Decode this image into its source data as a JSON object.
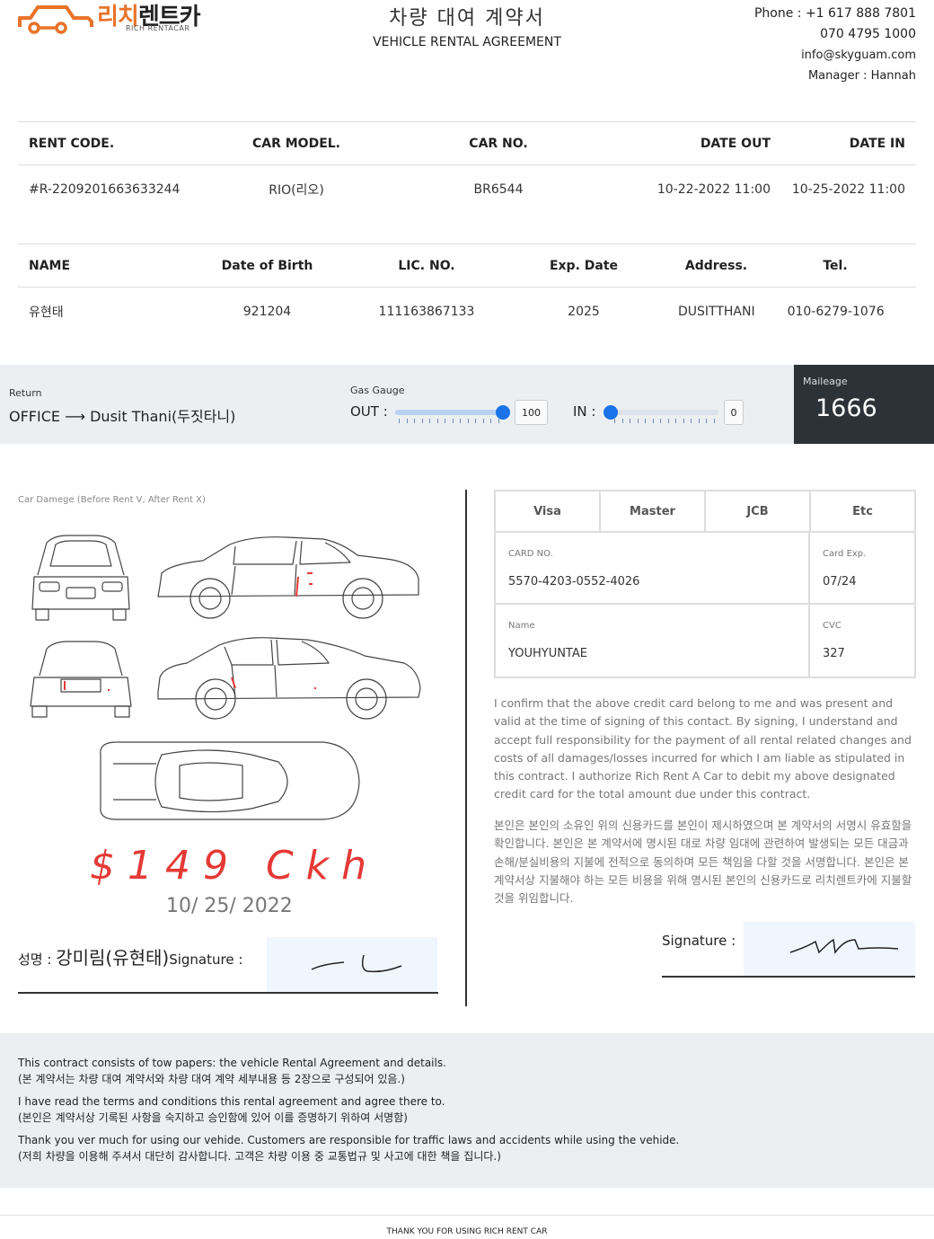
{
  "brand": {
    "name_part1": "리치",
    "name_part2": "렌트카",
    "sub": "RICH RENTACAR",
    "accent": "#e8732a"
  },
  "title": {
    "ko": "차량 대여 계약서",
    "en": "VEHICLE RENTAL AGREEMENT"
  },
  "contact": {
    "phone1": "Phone : +1 617 888 7801",
    "phone2": "070 4795 1000",
    "email": "info@skyguam.com",
    "manager": "Manager : Hannah"
  },
  "rental": {
    "headers": [
      "RENT CODE.",
      "CAR MODEL.",
      "CAR NO.",
      "DATE OUT",
      "DATE IN"
    ],
    "values": [
      "#R-2209201663633244",
      "RIO(리오)",
      "BR6544",
      "10-22-2022 11:00",
      "10-25-2022 11:00"
    ]
  },
  "customer": {
    "headers": [
      "NAME",
      "Date of Birth",
      "LIC. NO.",
      "Exp. Date",
      "Address.",
      "Tel."
    ],
    "values": [
      "유현태",
      "921204",
      "111163867133",
      "2025",
      "DUSITTHANI",
      "010-6279-1076"
    ]
  },
  "status": {
    "return_label": "Return",
    "return_value": "OFFICE ⟶ Dusit Thani(두짓타니)",
    "gas_label": "Gas Gauge",
    "out_label": "OUT :",
    "out_value": "100",
    "out_level": 1.0,
    "in_label": "IN :",
    "in_value": "0",
    "in_level": 0.0,
    "mileage_label": "Maileage",
    "mileage_value": "1666"
  },
  "damage": {
    "label": "Car Damege (Before Rent V, After Rent X)",
    "handwritten_amount": "$149 Ckh",
    "handwritten_date": "10/ 25/ 2022"
  },
  "signature_left": {
    "label_ko": "성명 : ",
    "name": "강미림(유현태)",
    "label": "Signature :"
  },
  "payment": {
    "cards": [
      "Visa",
      "Master",
      "JCB",
      "Etc"
    ],
    "card_no_label": "CARD NO.",
    "card_no": "5570-4203-0552-4026",
    "card_exp_label": "Card Exp.",
    "card_exp": "07/24",
    "name_label": "Name",
    "name": "YOUHYUNTAE",
    "cvc_label": "CVC",
    "cvc": "327"
  },
  "terms": {
    "en": "I confirm that the above credit card belong to me and was present and valid at the time of signing of this contact. By signing, I understand and accept full responsibility for the payment of all rental related changes and costs of all damages/losses incurred for which I am liable as stipulated in this contract. I authorize Rich Rent A Car to debit my above designated credit card for the total amount due under this contract.",
    "ko": "본인은 본인의 소유인 위의 신용카드를 본인이 제시하였으며 본 계약서의 서명시 유효함을 확인합니다. 본인은 본 계약서에 명시된 대로 차량 임대에 관련하여 발생되는 모든 대금과 손해/분실비용의 지불에 전적으로 동의하며 모든 책임을 다할 것을 서명합니다. 본인은 본 계약서상 지불해야 하는 모든 비용을 위해 명시된 본인의 신용카드로 리치렌트카에 지불할 것을 위임합니다."
  },
  "signature_right": {
    "label": "Signature :"
  },
  "notes": [
    "This contract consists of tow papers: the vehicle Rental Agreement and details.",
    "(본 계약서는 차량 대여 계약서와 차량 대여 계약 세부내용 등 2장으로 구성되어 있음.)",
    "I have read the terms and conditions this rental agreement and agree there to.",
    "(본인은 계약서상 기록된 사항을 숙지하고 승인함에 있어 이를 증명하기 위하여 서명함)",
    "Thank you ver much for using our vehide. Customers are responsible for traffic laws and accidents while using the vehide.",
    "(저희 차량을 이용해 주셔서 대단히 감사합니다. 고객은 차량 이용 중 교통법규 및 사고에 대한 책을 집니다.)"
  ],
  "footer": "THANK YOU FOR USING RICH RENT CAR"
}
